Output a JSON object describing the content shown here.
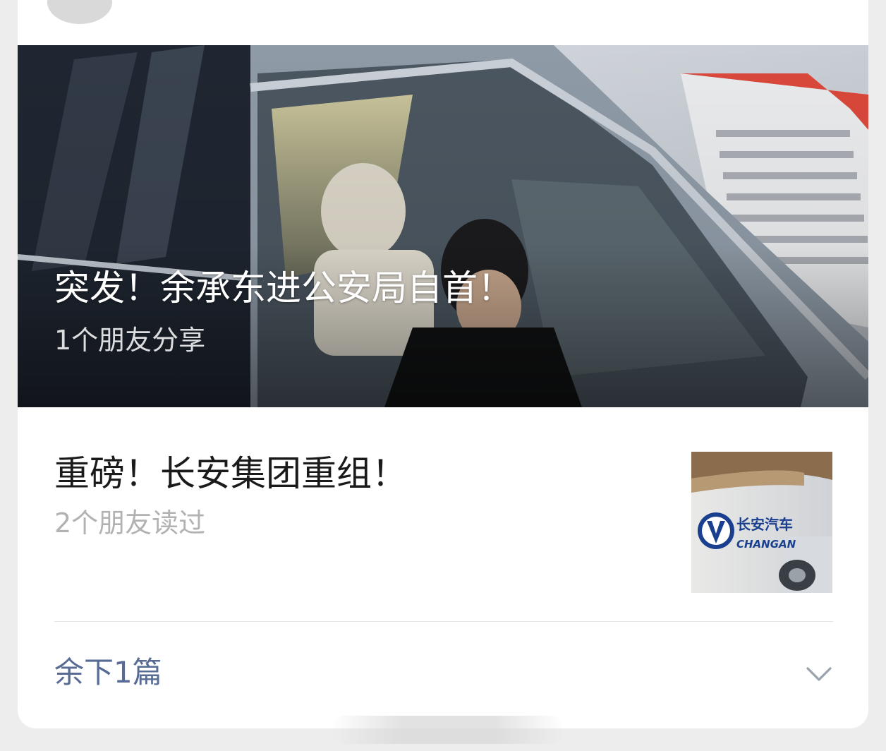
{
  "header": {
    "account_name": "",
    "time": ""
  },
  "hero": {
    "title": "突发！余承东进公安局自首！",
    "subtitle": "1个朋友分享"
  },
  "article": {
    "title": "重磅！长安集团重组！",
    "subtitle": "2个朋友读过",
    "thumbnail_logo_text_cn": "长安汽车",
    "thumbnail_logo_text_en": "CHANGAN"
  },
  "more": {
    "label": "余下1篇",
    "icon": "chevron-down-icon"
  },
  "colors": {
    "link": "#576b95",
    "secondary_text": "#b2b2b2",
    "primary_text": "#1a1a1a",
    "background": "#ededed",
    "card": "#ffffff"
  }
}
